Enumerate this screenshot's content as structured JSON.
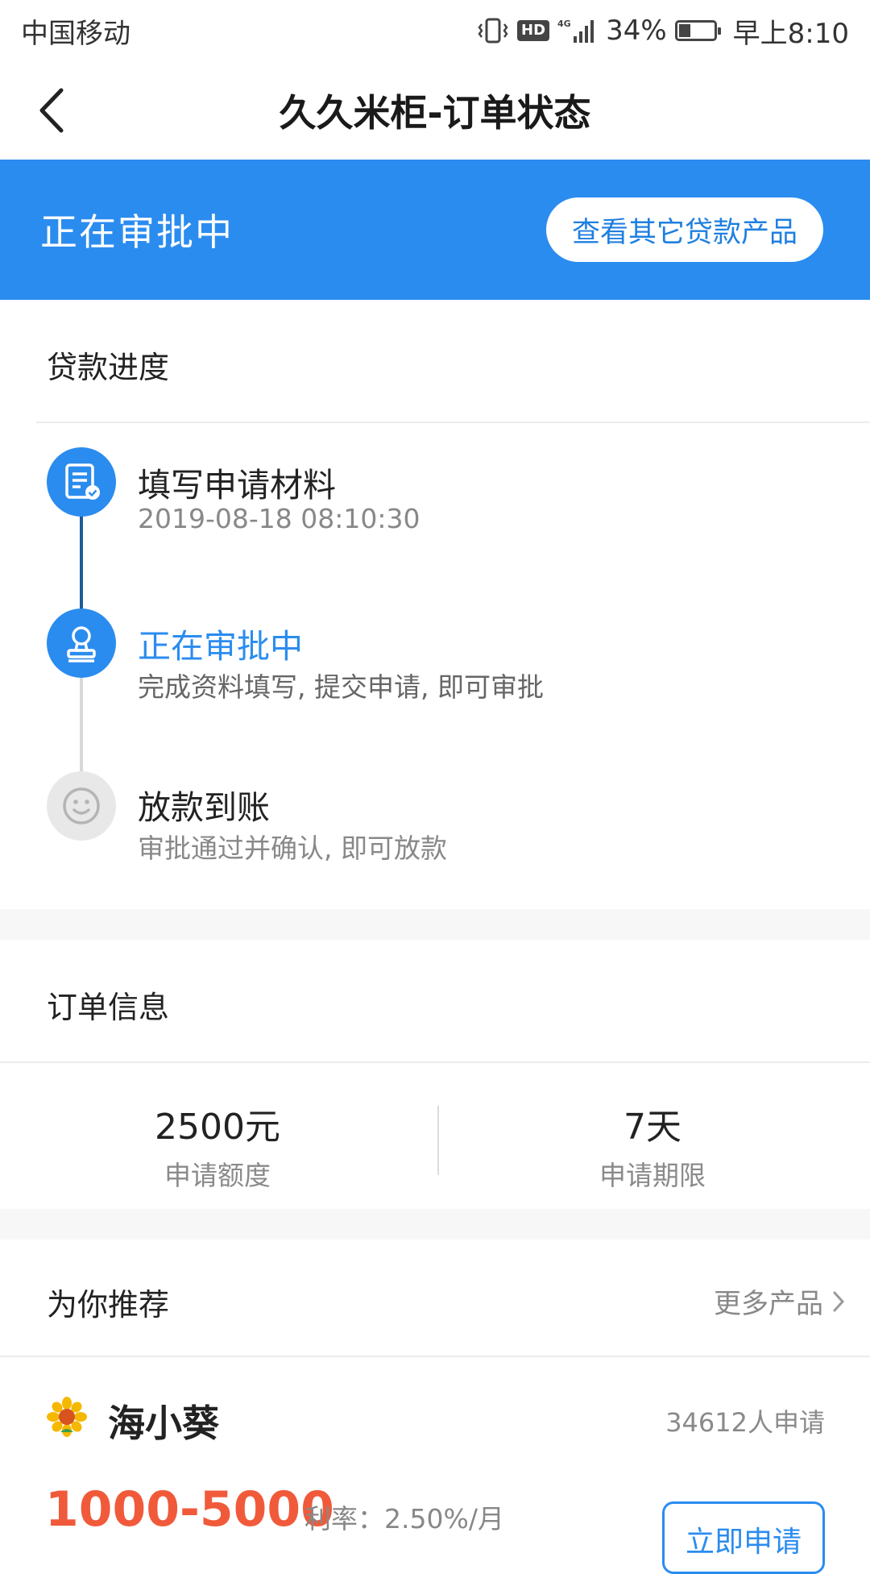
{
  "status_bar": {
    "carrier": "中国移动",
    "network": "4G",
    "battery": "34%",
    "time": "早上8:10"
  },
  "nav": {
    "title": "久久米柜-订单状态"
  },
  "banner": {
    "status": "正在审批中",
    "button": "查看其它贷款产品",
    "color": "#2b8cef"
  },
  "progress": {
    "title": "贷款进度",
    "steps": [
      {
        "title": "填写申请材料",
        "subtitle": "2019-08-18 08:10:30",
        "state": "done"
      },
      {
        "title": "正在审批中",
        "subtitle": "完成资料填写, 提交申请, 即可审批",
        "state": "active"
      },
      {
        "title": "放款到账",
        "subtitle": "审批通过并确认, 即可放款",
        "state": "pending"
      }
    ]
  },
  "order": {
    "title": "订单信息",
    "amount_value": "2500元",
    "amount_label": "申请额度",
    "term_value": "7天",
    "term_label": "申请期限"
  },
  "recommend": {
    "title": "为你推荐",
    "more": "更多产品",
    "product": {
      "name": "海小葵",
      "applicants": "34612人申请",
      "amount_range": "1000-5000",
      "rate": "利率：2.50%/月",
      "apply": "立即申请"
    }
  }
}
